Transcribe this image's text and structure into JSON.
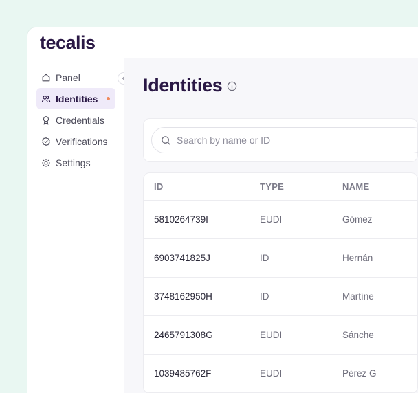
{
  "brand": {
    "logo_text": "tecalis"
  },
  "sidebar": {
    "items": [
      {
        "label": "Panel",
        "icon": "home-icon",
        "active": false
      },
      {
        "label": "Identities",
        "icon": "users-icon",
        "active": true
      },
      {
        "label": "Credentials",
        "icon": "award-icon",
        "active": false
      },
      {
        "label": "Verifications",
        "icon": "badge-check-icon",
        "active": false
      },
      {
        "label": "Settings",
        "icon": "gear-icon",
        "active": false
      }
    ],
    "collapse_icon": "chevron-left-icon"
  },
  "main": {
    "title": "Identities",
    "title_icon": "info-icon",
    "search": {
      "placeholder": "Search by name or ID",
      "value": ""
    },
    "table": {
      "headers": [
        "ID",
        "TYPE",
        "NAME"
      ],
      "rows": [
        {
          "id": "5810264739I",
          "type": "EUDI",
          "name": "Gómez"
        },
        {
          "id": "6903741825J",
          "type": "ID",
          "name": "Hernán"
        },
        {
          "id": "3748162950H",
          "type": "ID",
          "name": "Martíne"
        },
        {
          "id": "2465791308G",
          "type": "EUDI",
          "name": "Sánche"
        },
        {
          "id": "1039485762F",
          "type": "EUDI",
          "name": "Pérez G"
        }
      ]
    }
  },
  "colors": {
    "brand": "#2a1845",
    "accent": "#efeaf9",
    "dot": "#f08a5d",
    "background": "#e9f7f2"
  }
}
